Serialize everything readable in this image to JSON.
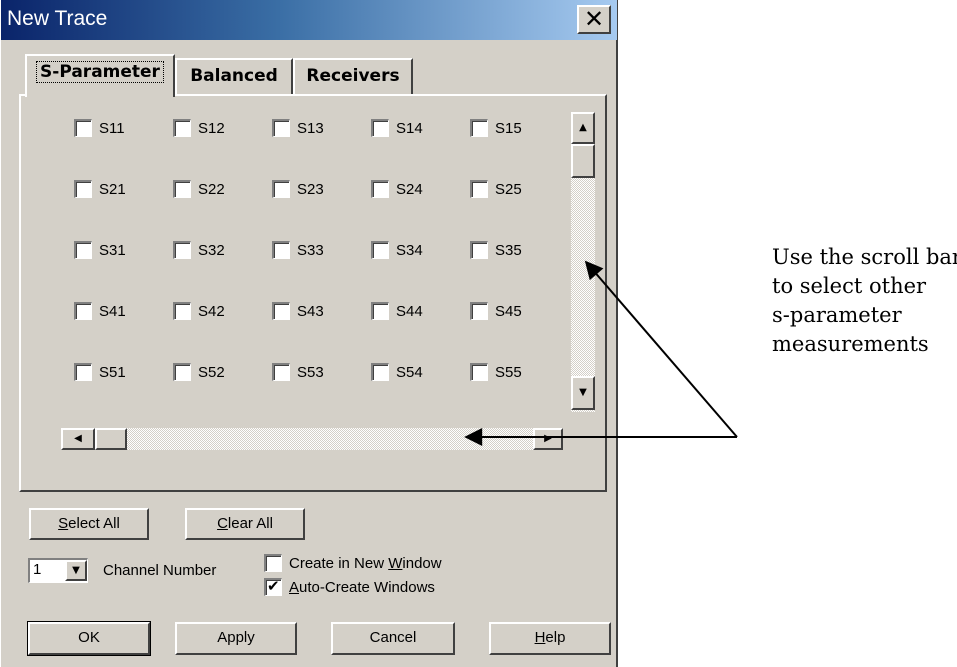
{
  "window": {
    "title": "New Trace",
    "close_symbol": "✕"
  },
  "tabs": [
    {
      "label": "S-Parameter",
      "active": true
    },
    {
      "label": "Balanced",
      "active": false
    },
    {
      "label": "Receivers",
      "active": false
    }
  ],
  "s_parameters": [
    [
      "S11",
      "S12",
      "S13",
      "S14",
      "S15"
    ],
    [
      "S21",
      "S22",
      "S23",
      "S24",
      "S25"
    ],
    [
      "S31",
      "S32",
      "S33",
      "S34",
      "S35"
    ],
    [
      "S41",
      "S42",
      "S43",
      "S44",
      "S45"
    ],
    [
      "S51",
      "S52",
      "S53",
      "S54",
      "S55"
    ]
  ],
  "scrollbars": {
    "up_symbol": "▲",
    "down_symbol": "▼",
    "left_symbol": "◀",
    "right_symbol": "▶"
  },
  "buttons": {
    "select_all": {
      "mnemonic": "S",
      "rest": "elect All"
    },
    "clear_all": {
      "mnemonic": "C",
      "rest": "lear All"
    },
    "ok": "OK",
    "apply": "Apply",
    "cancel": "Cancel",
    "help": {
      "mnemonic": "H",
      "rest": "elp"
    }
  },
  "channel": {
    "value": "1",
    "label": "Channel Number",
    "dropdown_symbol": "▼"
  },
  "options": {
    "create_new_window": {
      "before": "Create in New ",
      "mnemonic": "W",
      "after": "indow",
      "checked": false
    },
    "auto_create": {
      "mnemonic": "A",
      "rest": "uto-Create Windows",
      "checked": true
    }
  },
  "annotation": {
    "lines": [
      "Use the scroll bar",
      "to select other",
      "s-parameter",
      "measurements"
    ]
  },
  "colors": {
    "dialog_bg": "#d4d0c8",
    "title_start": "#0a246a",
    "title_end": "#a6caf0",
    "title_text": "#ffffff"
  }
}
